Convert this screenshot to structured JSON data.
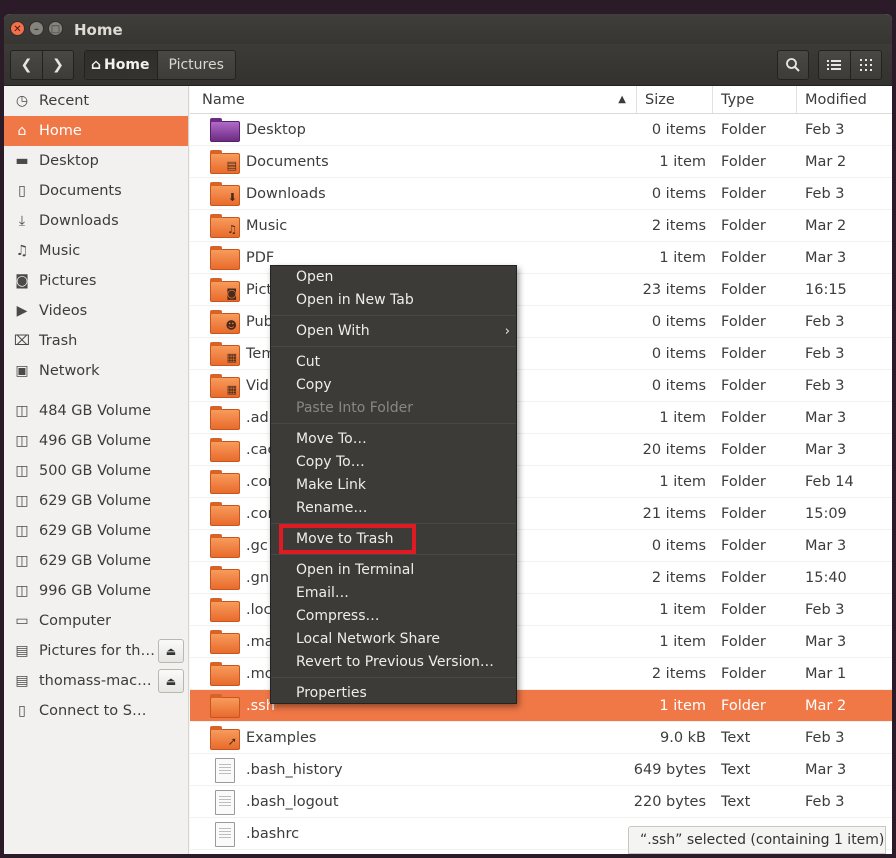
{
  "window": {
    "title": "Home"
  },
  "toolbar": {
    "back_icon": "chevron-left-icon",
    "forward_icon": "chevron-right-icon",
    "breadcrumbs": [
      "Home",
      "Pictures"
    ],
    "search_icon": "search-icon",
    "list_view_icon": "list-view-icon",
    "grid_view_icon": "grid-view-icon"
  },
  "sidebar": {
    "places": [
      {
        "label": "Recent",
        "icon": "clock-icon"
      },
      {
        "label": "Home",
        "icon": "home-icon",
        "active": true
      },
      {
        "label": "Desktop",
        "icon": "folder-icon"
      },
      {
        "label": "Documents",
        "icon": "document-icon"
      },
      {
        "label": "Downloads",
        "icon": "download-icon"
      },
      {
        "label": "Music",
        "icon": "music-icon"
      },
      {
        "label": "Pictures",
        "icon": "camera-icon"
      },
      {
        "label": "Videos",
        "icon": "video-icon"
      },
      {
        "label": "Trash",
        "icon": "trash-icon"
      },
      {
        "label": "Network",
        "icon": "network-icon"
      }
    ],
    "volumes": [
      {
        "label": "484 GB Volume"
      },
      {
        "label": "496 GB Volume"
      },
      {
        "label": "500 GB Volume"
      },
      {
        "label": "629 GB Volume"
      },
      {
        "label": "629 GB Volume"
      },
      {
        "label": "629 GB Volume"
      },
      {
        "label": "996 GB Volume"
      },
      {
        "label": "Computer"
      },
      {
        "label": "Pictures for th…"
      },
      {
        "label": "thomass-mac-…"
      },
      {
        "label": "Connect to Server"
      }
    ]
  },
  "columns": {
    "name": "Name",
    "size": "Size",
    "type": "Type",
    "modified": "Modified"
  },
  "files": [
    {
      "name": "Desktop",
      "size": "0 items",
      "type": "Folder",
      "modified": "Feb 3"
    },
    {
      "name": "Documents",
      "size": "1 item",
      "type": "Folder",
      "modified": "Mar 2"
    },
    {
      "name": "Downloads",
      "size": "0 items",
      "type": "Folder",
      "modified": "Feb 3"
    },
    {
      "name": "Music",
      "size": "2 items",
      "type": "Folder",
      "modified": "Mar 2"
    },
    {
      "name": "PDF",
      "size": "1 item",
      "type": "Folder",
      "modified": "Mar 3"
    },
    {
      "name": "Pict",
      "size": "23 items",
      "type": "Folder",
      "modified": "16:15"
    },
    {
      "name": "Pub",
      "size": "0 items",
      "type": "Folder",
      "modified": "Feb 3"
    },
    {
      "name": "Tem",
      "size": "0 items",
      "type": "Folder",
      "modified": "Feb 3"
    },
    {
      "name": "Vid",
      "size": "0 items",
      "type": "Folder",
      "modified": "Feb 3"
    },
    {
      "name": ".ad",
      "size": "1 item",
      "type": "Folder",
      "modified": "Mar 3"
    },
    {
      "name": ".cac",
      "size": "20 items",
      "type": "Folder",
      "modified": "Mar 3"
    },
    {
      "name": ".cor",
      "size": "1 item",
      "type": "Folder",
      "modified": "Feb 14"
    },
    {
      "name": ".cor",
      "size": "21 items",
      "type": "Folder",
      "modified": "15:09"
    },
    {
      "name": ".gc",
      "size": "0 items",
      "type": "Folder",
      "modified": "Mar 3"
    },
    {
      "name": ".gn",
      "size": "2 items",
      "type": "Folder",
      "modified": "15:40"
    },
    {
      "name": ".loc",
      "size": "1 item",
      "type": "Folder",
      "modified": "Feb 3"
    },
    {
      "name": ".ma",
      "size": "1 item",
      "type": "Folder",
      "modified": "Mar 3"
    },
    {
      "name": ".mo",
      "size": "2 items",
      "type": "Folder",
      "modified": "Mar 1"
    },
    {
      "name": ".ssh",
      "size": "1 item",
      "type": "Folder",
      "modified": "Mar 2",
      "selected": true
    },
    {
      "name": "Examples",
      "size": "9.0 kB",
      "type": "Text",
      "modified": "Feb 3"
    },
    {
      "name": ".bash_history",
      "size": "649 bytes",
      "type": "Text",
      "modified": "Mar 3"
    },
    {
      "name": ".bash_logout",
      "size": "220 bytes",
      "type": "Text",
      "modified": "Feb 3"
    },
    {
      "name": ".bashrc",
      "size": "",
      "type": "",
      "modified": ""
    }
  ],
  "context_menu": {
    "groups": [
      [
        "Open",
        "Open in New Tab"
      ],
      [
        "Open With"
      ],
      [
        "Cut",
        "Copy",
        "Paste Into Folder"
      ],
      [
        "Move To…",
        "Copy To…",
        "Make Link",
        "Rename…"
      ],
      [
        "Move to Trash"
      ],
      [
        "Open in Terminal",
        "Email…",
        "Compress…",
        "Local Network Share",
        "Revert to Previous Version…"
      ],
      [
        "Properties"
      ]
    ],
    "disabled": [
      "Paste Into Folder"
    ],
    "submenu": [
      "Open With"
    ],
    "highlighted": "Move to Trash"
  },
  "status": {
    "text": "“.ssh” selected  (containing 1 item)"
  },
  "colors": {
    "accent": "#f07746",
    "highlight_box": "#e01a22"
  }
}
